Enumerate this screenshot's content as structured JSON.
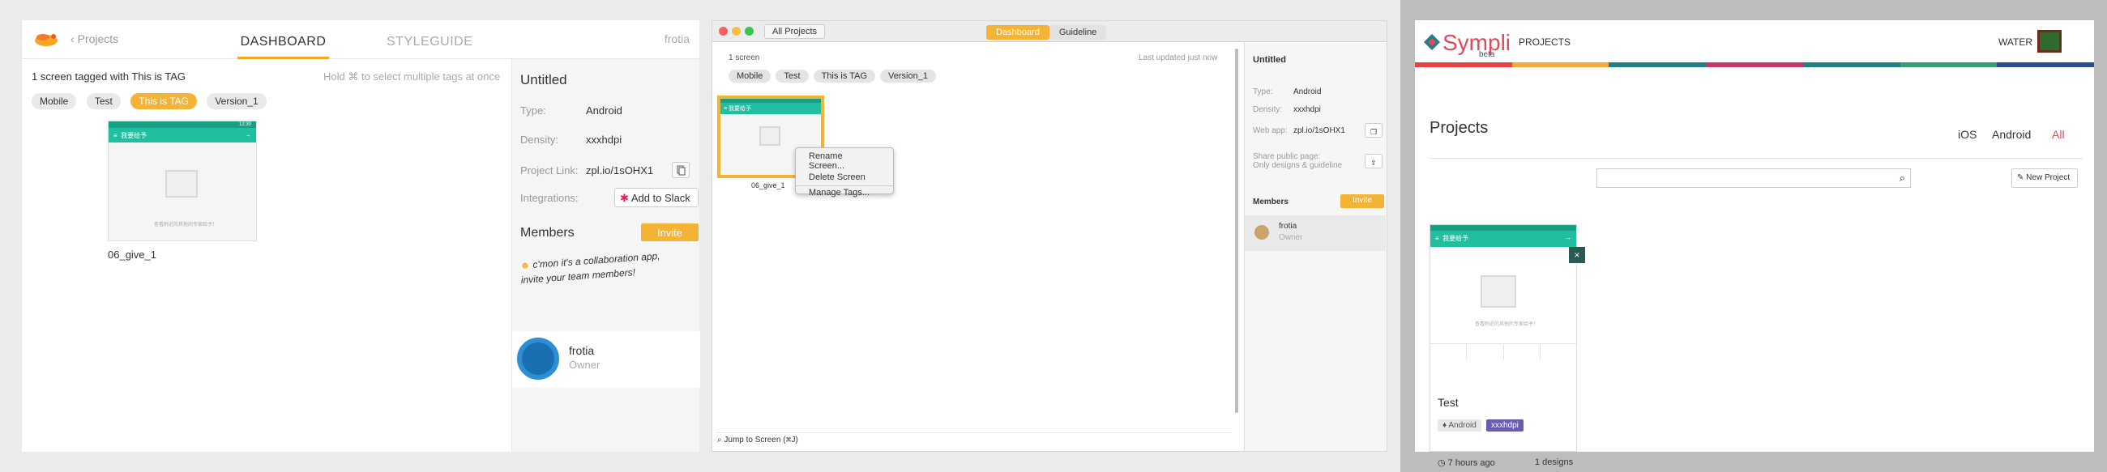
{
  "panel1": {
    "back": "Projects",
    "tabs": [
      "DASHBOARD",
      "STYLEGUIDE"
    ],
    "user": "frotia",
    "count_text": "1 screen tagged with This is TAG",
    "hint": "Hold ⌘ to select multiple tags at once",
    "tags": [
      "Mobile",
      "Test",
      "This is TAG",
      "Version_1"
    ],
    "active_tag": "This is TAG",
    "screen_title": "我要给予",
    "screen_time": "12:30",
    "screen_caption": "查看附近的其他的专家给予！",
    "screen_name": "06_give_1",
    "side": {
      "title": "Untitled",
      "type_label": "Type:",
      "type_value": "Android",
      "density_label": "Density:",
      "density_value": "xxxhdpi",
      "link_label": "Project Link:",
      "link_value": "zpl.io/1sOHX1",
      "integrations_label": "Integrations:",
      "slack_button": "Add to Slack",
      "members_label": "Members",
      "invite": "Invite",
      "note_line1": "c'mon it's a collaboration app,",
      "note_line2": "invite your team members!",
      "member_name": "frotia",
      "member_role": "Owner"
    }
  },
  "panel2": {
    "all_projects": "All Projects",
    "segments": [
      "Dashboard",
      "Guideline"
    ],
    "count": "1 screen",
    "updated": "Last updated just now",
    "tags": [
      "Mobile",
      "Test",
      "This is TAG",
      "Version_1"
    ],
    "screen_title": "我要给予",
    "screen_name": "06_give_1",
    "menu": [
      "Rename Screen...",
      "Delete Screen",
      "Manage Tags..."
    ],
    "jump": "Jump to Screen (⌘J)",
    "side": {
      "title": "Untitled",
      "type_label": "Type:",
      "type_value": "Android",
      "density_label": "Density:",
      "density_value": "xxxhdpi",
      "web_label": "Web app:",
      "web_value": "zpl.io/1sOHX1",
      "share_label": "Share public page:",
      "share_sub": "Only designs & guideline",
      "members_label": "Members",
      "invite": "Invite",
      "member_name": "frotia",
      "member_role": "Owner"
    }
  },
  "panel3": {
    "brand": "Sympli",
    "beta": "beta",
    "nav": "PROJECTS",
    "user": "WATER",
    "title": "Projects",
    "filters": [
      "iOS",
      "Android",
      "All"
    ],
    "active_filter": "All",
    "new_project": "New Project",
    "card_title": "我要给予",
    "card_caption": "查看附近的其他的专家给予！",
    "card_name": "Test",
    "platform": "Android",
    "density": "xxxhdpi",
    "time": "7 hours ago",
    "designs": "1 designs",
    "stripe_colors": [
      "#e8413f",
      "#f2a93b",
      "#1e7f86",
      "#c33a6a",
      "#1e7f86",
      "#34a06f",
      "#2d4e8e"
    ]
  },
  "colors": {
    "accent": "#f5b335",
    "teal": "#1fbfa0"
  }
}
